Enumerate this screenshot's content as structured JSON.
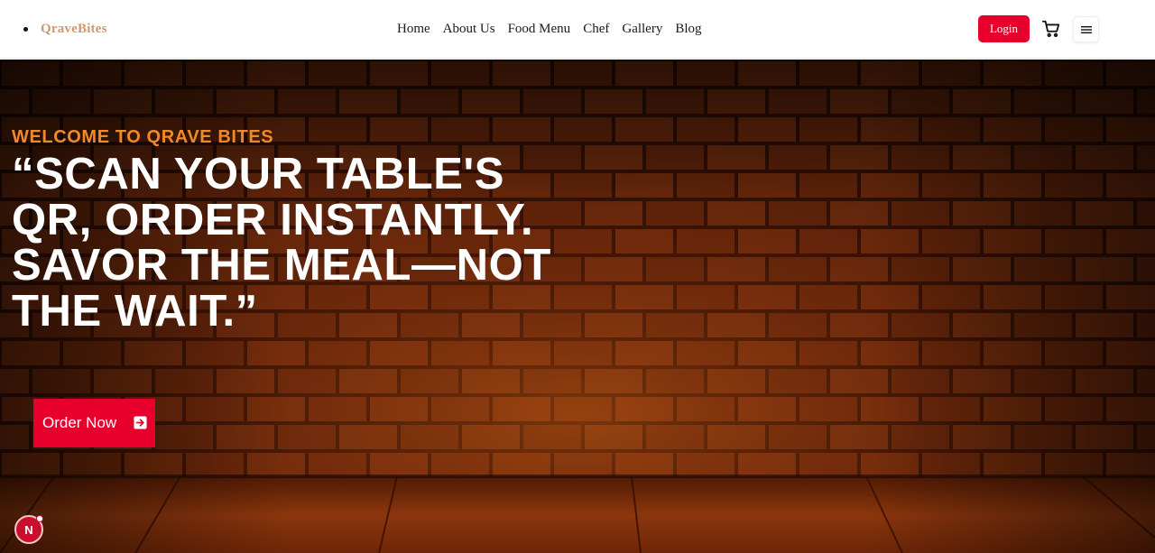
{
  "brand": {
    "name": "QraveBites"
  },
  "nav": {
    "items": [
      {
        "label": "Home"
      },
      {
        "label": "About Us"
      },
      {
        "label": "Food Menu"
      },
      {
        "label": "Chef"
      },
      {
        "label": "Gallery"
      },
      {
        "label": "Blog"
      }
    ],
    "login_label": "Login",
    "cart_icon": "cart-icon",
    "menu_icon": "hamburger-menu-icon"
  },
  "hero": {
    "eyebrow": "WELCOME TO QRAVE BITES",
    "title": "“SCAN YOUR TABLE'S QR, ORDER INSTANTLY. SAVOR THE MEAL—NOT THE WAIT.”",
    "cta_label": "Order Now",
    "cta_icon": "arrow-right-icon"
  },
  "floating_badge": {
    "letter": "N"
  },
  "colors": {
    "accent": "#e8002d",
    "brand": "#d4956a",
    "eyebrow": "#f08a28",
    "hero_text": "#ffffff",
    "nav_text": "#1a1a1a"
  }
}
